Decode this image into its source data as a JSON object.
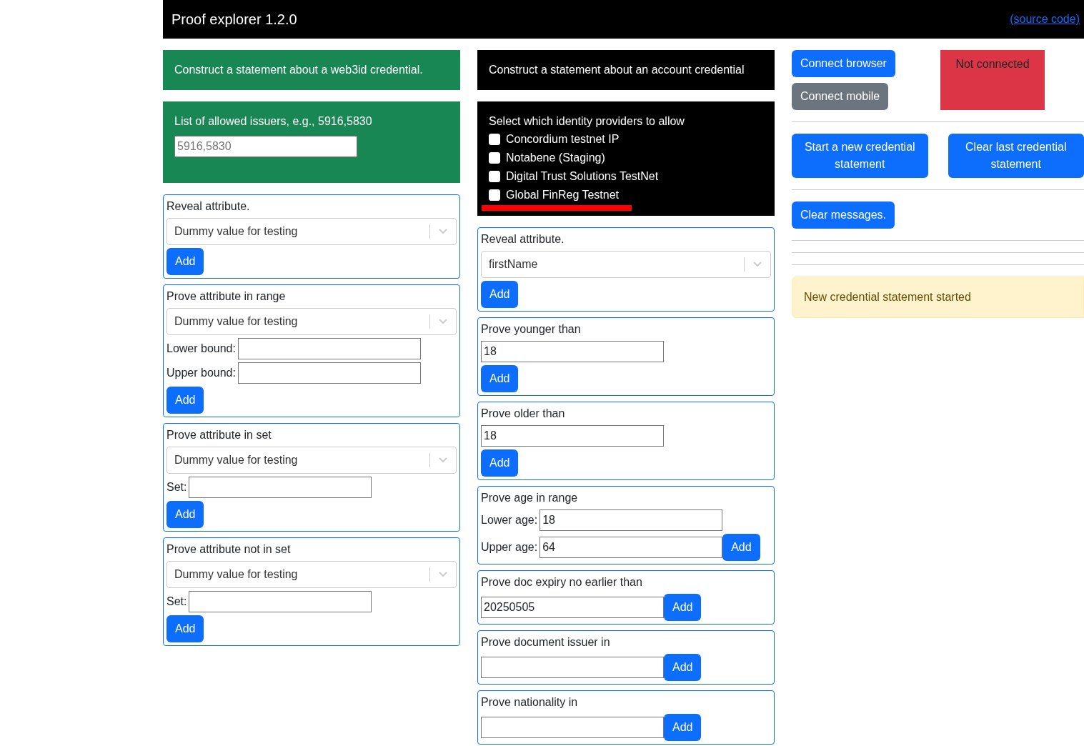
{
  "header": {
    "title": "Proof explorer 1.2.0",
    "link": "(source code)"
  },
  "web3id": {
    "heading": "Construct a statement about a web3id credential.",
    "issuers_label": "List of allowed issuers, e.g., 5916,5830",
    "issuers_placeholder": "5916,5830",
    "cards": [
      {
        "title": "Reveal attribute.",
        "rows": [
          [
            {
              "kind": "select",
              "value": "Dummy value for testing"
            }
          ],
          [
            {
              "kind": "button",
              "label": "Add"
            }
          ]
        ]
      },
      {
        "title": "Prove attribute in range",
        "rows": [
          [
            {
              "kind": "select",
              "value": "Dummy value for testing"
            }
          ],
          [
            {
              "kind": "label",
              "text": "Lower bound:"
            },
            {
              "kind": "input"
            }
          ],
          [
            {
              "kind": "label",
              "text": "Upper bound:"
            },
            {
              "kind": "input"
            }
          ],
          [
            {
              "kind": "button",
              "label": "Add"
            }
          ]
        ]
      },
      {
        "title": "Prove attribute in set",
        "rows": [
          [
            {
              "kind": "select",
              "value": "Dummy value for testing"
            }
          ],
          [
            {
              "kind": "label",
              "text": "Set:"
            },
            {
              "kind": "input"
            }
          ],
          [
            {
              "kind": "button",
              "label": "Add"
            }
          ]
        ]
      },
      {
        "title": "Prove attribute not in set",
        "rows": [
          [
            {
              "kind": "select",
              "value": "Dummy value for testing"
            }
          ],
          [
            {
              "kind": "label",
              "text": "Set:"
            },
            {
              "kind": "input"
            }
          ],
          [
            {
              "kind": "button",
              "label": "Add"
            }
          ]
        ]
      }
    ]
  },
  "account": {
    "heading": "Construct a statement about an account credential",
    "providers_label": "Select which identity providers to allow",
    "providers": [
      {
        "label": "Concordium testnet IP",
        "checked": false,
        "underlined": false
      },
      {
        "label": "Notabene (Staging)",
        "checked": false,
        "underlined": false
      },
      {
        "label": "Digital Trust Solutions TestNet",
        "checked": false,
        "underlined": false
      },
      {
        "label": "Global FinReg Testnet",
        "checked": false,
        "underlined": true
      }
    ],
    "cards": [
      {
        "title": "Reveal attribute.",
        "rows": [
          [
            {
              "kind": "select",
              "value": "firstName"
            }
          ],
          [
            {
              "kind": "button",
              "label": "Add"
            }
          ]
        ]
      },
      {
        "title": "Prove younger than",
        "rows": [
          [
            {
              "kind": "input",
              "value": "18"
            }
          ],
          [
            {
              "kind": "button",
              "label": "Add"
            }
          ]
        ]
      },
      {
        "title": "Prove older than",
        "rows": [
          [
            {
              "kind": "input",
              "value": "18"
            }
          ],
          [
            {
              "kind": "button",
              "label": "Add"
            }
          ]
        ]
      },
      {
        "title": "Prove age in range",
        "rows": [
          [
            {
              "kind": "label",
              "text": "Lower age:"
            },
            {
              "kind": "input",
              "value": "18"
            }
          ],
          [
            {
              "kind": "label",
              "text": "Upper age:"
            },
            {
              "kind": "input",
              "value": "64"
            },
            {
              "kind": "button",
              "label": "Add"
            }
          ]
        ]
      },
      {
        "title": "Prove doc expiry no earlier than",
        "rows": [
          [
            {
              "kind": "input",
              "value": "20250505"
            },
            {
              "kind": "button",
              "label": "Add"
            }
          ]
        ]
      },
      {
        "title": "Prove document issuer in",
        "rows": [
          [
            {
              "kind": "input"
            },
            {
              "kind": "button",
              "label": "Add"
            }
          ]
        ]
      },
      {
        "title": "Prove nationality in",
        "rows": [
          [
            {
              "kind": "input"
            },
            {
              "kind": "button",
              "label": "Add"
            }
          ]
        ]
      }
    ]
  },
  "controls": {
    "connect_buttons": [
      {
        "label": "Connect browser",
        "kind": "primary"
      },
      {
        "label": "Connect mobile",
        "kind": "secondary"
      }
    ],
    "status": "Not connected",
    "statement_buttons": [
      {
        "label": "Start a new credential statement"
      },
      {
        "label": "Clear last credential statement"
      }
    ],
    "clear_button": "Clear messages.",
    "message": "New credential statement started"
  }
}
